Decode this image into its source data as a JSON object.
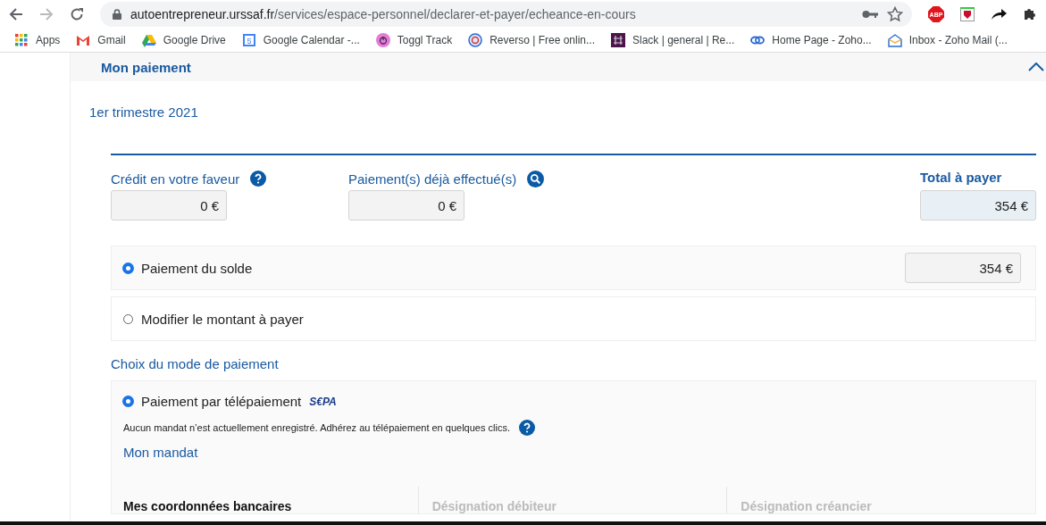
{
  "browser": {
    "url_host": "autoentrepreneur.urssaf.fr",
    "url_path": "/services/espace-personnel/declarer-et-payer/echeance-en-cours",
    "extensions": [
      {
        "kind": "abp",
        "label": "ABP"
      },
      {
        "kind": "shield"
      },
      {
        "kind": "arrow"
      },
      {
        "kind": "puzzle"
      }
    ]
  },
  "bookmarks": [
    {
      "kind": "apps",
      "label": "Apps"
    },
    {
      "kind": "gmail",
      "label": "Gmail"
    },
    {
      "kind": "drive",
      "label": "Google Drive"
    },
    {
      "kind": "calendar",
      "label": "Google Calendar -...",
      "badge": "5"
    },
    {
      "kind": "toggl",
      "label": "Toggl Track"
    },
    {
      "kind": "reverso",
      "label": "Reverso | Free onlin..."
    },
    {
      "kind": "slack",
      "label": "Slack | general | Re..."
    },
    {
      "kind": "zoho",
      "label": "Home Page - Zoho..."
    },
    {
      "kind": "mail",
      "label": "Inbox - Zoho Mail (..."
    }
  ],
  "section": {
    "title": "Mon paiement",
    "expanded": true
  },
  "period": "1er trimestre 2021",
  "amounts": [
    {
      "label": "Crédit en votre faveur",
      "kind": "help",
      "value": "0 €"
    },
    {
      "label": "Paiement(s) déjà effectué(s)",
      "kind": "search",
      "value": "0 €"
    }
  ],
  "total": {
    "label": "Total à payer",
    "value": "354 €"
  },
  "amount_options": [
    {
      "label": "Paiement du solde",
      "selected": true,
      "value": "354 €"
    },
    {
      "label": "Modifier le montant à payer",
      "selected": false
    }
  ],
  "mode_title": "Choix du mode de paiement",
  "modes": [
    {
      "label": "Paiement par télépaiement",
      "selected": true,
      "logo": "S€PA",
      "note": "Aucun mandat n’est actuellement enregistré. Adhérez au télépaiement en quelques clics.",
      "link": "Mon mandat"
    }
  ],
  "bank_columns": [
    {
      "label": "Mes coordonnées bancaires",
      "active": true
    },
    {
      "label": "Désignation débiteur",
      "active": false
    },
    {
      "label": "Désignation créancier",
      "active": false
    }
  ]
}
